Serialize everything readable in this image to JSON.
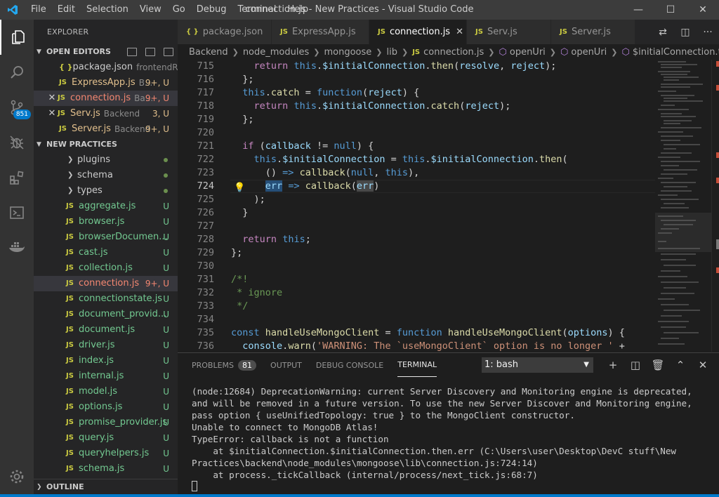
{
  "window": {
    "title": "connection.js - New Practices - Visual Studio Code",
    "menu": [
      "File",
      "Edit",
      "Selection",
      "View",
      "Go",
      "Debug",
      "Terminal",
      "Help"
    ],
    "controls": {
      "minimize": "—",
      "maximize": "☐",
      "close": "✕"
    }
  },
  "activity": {
    "scm_badge": "851"
  },
  "sidebar": {
    "title": "EXPLORER",
    "open_editors": {
      "label": "OPEN EDITORS",
      "items": [
        {
          "name": "package.json",
          "desc": "frontendRe...",
          "status": "",
          "icon": "{ }"
        },
        {
          "name": "ExpressApp.js",
          "desc": "B...",
          "status": "9+, U",
          "icon": "JS"
        },
        {
          "name": "connection.js",
          "desc": "Ba...",
          "status": "9+, U",
          "icon": "JS"
        },
        {
          "name": "Serv.js",
          "desc": "Backend",
          "status": "3, U",
          "icon": "JS"
        },
        {
          "name": "Server.js",
          "desc": "Backend",
          "status": "9+, U",
          "icon": "JS"
        }
      ]
    },
    "project": {
      "label": "NEW PRACTICES",
      "folders": [
        "plugins",
        "schema",
        "types"
      ],
      "files": [
        {
          "name": "aggregate.js",
          "status": "U"
        },
        {
          "name": "browser.js",
          "status": "U"
        },
        {
          "name": "browserDocumen...",
          "status": "U"
        },
        {
          "name": "cast.js",
          "status": "U"
        },
        {
          "name": "collection.js",
          "status": "U"
        },
        {
          "name": "connection.js",
          "status": "9+, U"
        },
        {
          "name": "connectionstate.js",
          "status": "U"
        },
        {
          "name": "document_provid...",
          "status": "U"
        },
        {
          "name": "document.js",
          "status": "U"
        },
        {
          "name": "driver.js",
          "status": "U"
        },
        {
          "name": "index.js",
          "status": "U"
        },
        {
          "name": "internal.js",
          "status": "U"
        },
        {
          "name": "model.js",
          "status": "U"
        },
        {
          "name": "options.js",
          "status": "U"
        },
        {
          "name": "promise_provider.js",
          "status": "U"
        },
        {
          "name": "query.js",
          "status": "U"
        },
        {
          "name": "queryhelpers.js",
          "status": "U"
        },
        {
          "name": "schema.js",
          "status": "U"
        }
      ]
    },
    "outline_label": "OUTLINE"
  },
  "tabs": [
    {
      "label": "package.json",
      "icon": "{ }"
    },
    {
      "label": "ExpressApp.js",
      "icon": "JS"
    },
    {
      "label": "connection.js",
      "icon": "JS"
    },
    {
      "label": "Serv.js",
      "icon": "JS"
    },
    {
      "label": "Server.js",
      "icon": "JS"
    }
  ],
  "breadcrumb": [
    "Backend",
    "node_modules",
    "mongoose",
    "lib",
    "connection.js",
    "openUri",
    "openUri",
    "$initialConnection.then() callba"
  ],
  "editor": {
    "line_numbers": [
      "715",
      "716",
      "717",
      "718",
      "719",
      "720",
      "721",
      "722",
      "723",
      "724",
      "725",
      "726",
      "727",
      "728",
      "729",
      "730",
      "731",
      "732",
      "733",
      "734",
      "735",
      "736"
    ]
  },
  "panel": {
    "tabs": [
      "PROBLEMS",
      "OUTPUT",
      "DEBUG CONSOLE",
      "TERMINAL"
    ],
    "problems_count": "81",
    "terminal_select": "1: bash",
    "terminal_lines": [
      "(node:12684) DeprecationWarning: current Server Discovery and Monitoring engine is deprecated, and will be removed in a future version. To use the new Server Discover and Monitoring engine, pass option { useUnifiedTopology: true } to the MongoClient constructor.",
      "Unable to connect to MongoDB Atlas!",
      "TypeError: callback is not a function",
      "    at $initialConnection.$initialConnection.then.err (C:\\Users\\user\\Desktop\\DevC stuff\\New Practices\\backend\\node_modules\\mongoose\\lib\\connection.js:724:14)",
      "    at process._tickCallback (internal/process/next_tick.js:68:7)"
    ]
  }
}
